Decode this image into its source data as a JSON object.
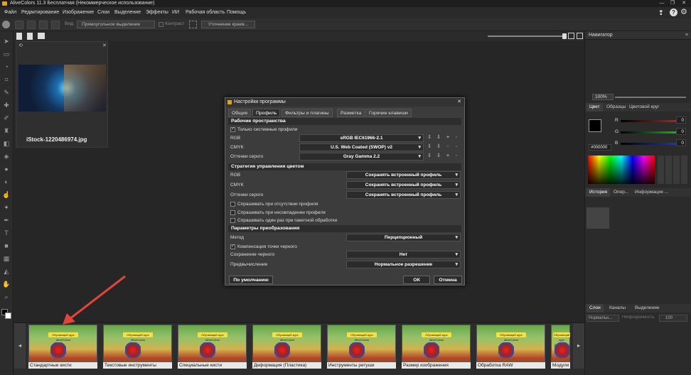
{
  "window": {
    "title": "AliveColors 11.3 Бесплатная (Некоммерческое использование)"
  },
  "menu": [
    "Файл",
    "Редактирование",
    "Изображение",
    "Слои",
    "Выделение",
    "Эффекты",
    "ИИ",
    "Рабочая область",
    "Помощь"
  ],
  "options": {
    "view_label": "Вид:",
    "selection_type": "Прямоугольное выделение",
    "contrast_label": "Контраст",
    "refine_label": "Уточнение краев..."
  },
  "document": {
    "filename": "iStock-1220486974.jpg"
  },
  "navigator": {
    "title": "Навигатор",
    "zoom": "100%"
  },
  "color_panel": {
    "tabs": [
      "Цвет",
      "Образцы",
      "Цветовой круг"
    ],
    "r_label": "R",
    "g_label": "G",
    "b_label": "B",
    "r": "0",
    "g": "0",
    "b": "0",
    "hex": "#000000"
  },
  "history_panel": {
    "tabs": [
      "История",
      "Опер...",
      "Информация ..."
    ]
  },
  "layers_panel": {
    "tabs": [
      "Слои",
      "Каналы",
      "Выделение"
    ],
    "blend": "Нормальн...",
    "opacity_label": "Непрозрачность",
    "opacity": "100"
  },
  "dialog": {
    "title": "Настройки программы",
    "tabs": [
      "Общие",
      "Профиль",
      "Фильтры и плагины",
      "Разметка",
      "Горячие клавиши"
    ],
    "workspaces": {
      "header": "Рабочие пространства",
      "system_only": "Только системные профили",
      "rgb_label": "RGB",
      "rgb_value": "sRGB IEC61966-2.1",
      "cmyk_label": "CMYK",
      "cmyk_value": "U.S. Web Coated (SWOP) v2",
      "gray_label": "Оттенки серого",
      "gray_value": "Gray Gamma 2.2"
    },
    "strategy": {
      "header": "Стратегия управления цветом",
      "rgb_label": "RGB",
      "rgb_value": "Сохранять встроенный профиль",
      "cmyk_label": "CMYK",
      "cmyk_value": "Сохранять встроенный профиль",
      "gray_label": "Оттенки серого",
      "gray_value": "Сохранять встроенный профиль",
      "ask_missing": "Спрашивать при отсутствии профиля",
      "ask_mismatch": "Спрашивать при несовпадении профиля",
      "ask_batch": "Спрашивать один раз при пакетной обработке"
    },
    "conversion": {
      "header": "Параметры преобразования",
      "method_label": "Метод",
      "method_value": "Перцепционный",
      "black_comp": "Компенсация точки черного",
      "keep_black_label": "Сохранение черного",
      "keep_black_value": "Нет",
      "precalc_label": "Предвычисление",
      "precalc_value": "Нормальное разрешение"
    },
    "buttons": {
      "defaults": "По умолчанию",
      "ok": "ОК",
      "cancel": "Отмена"
    }
  },
  "filmstrip": {
    "banner": "Обучающий курс AliveColors",
    "items": [
      "Стандартные кисти",
      "Текстовые инструменты",
      "Специальные кисти",
      "Деформация (Пластика)",
      "Инструменты ретуши",
      "Размер изображения",
      "Обработка RAW",
      "Модули"
    ]
  },
  "colors": {
    "accent": "#e3a21a",
    "arrow": "#e0443a",
    "dialog_bg": "#3c3c3c"
  }
}
